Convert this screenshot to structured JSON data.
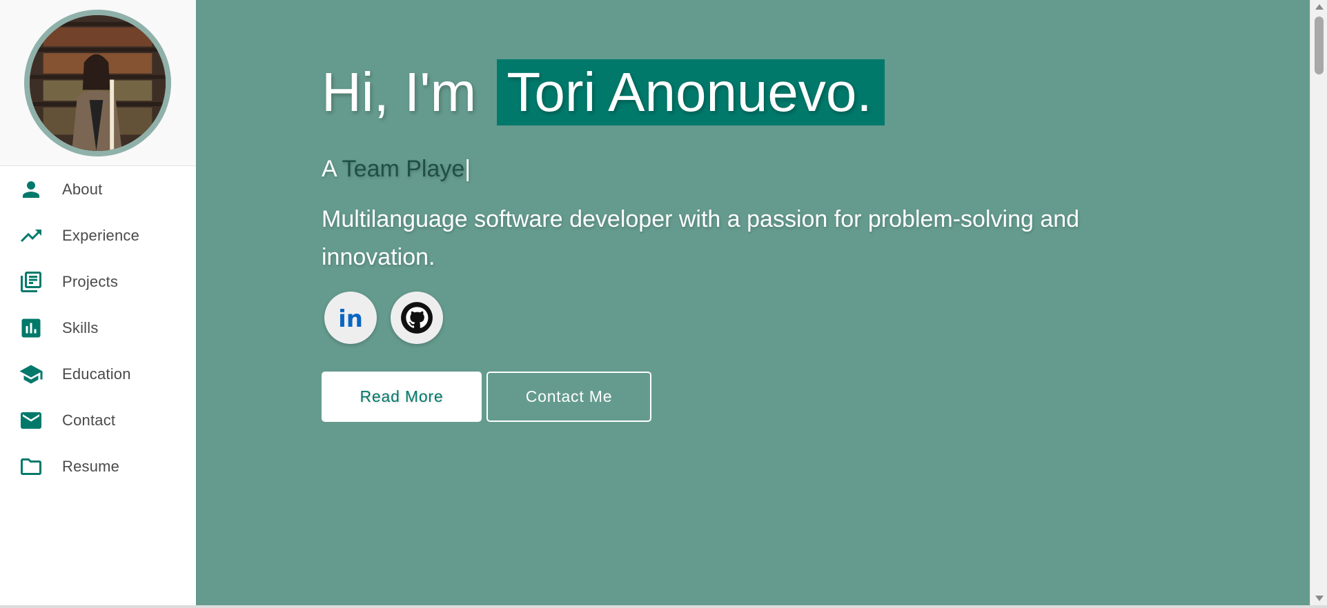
{
  "sidebar": {
    "items": [
      {
        "label": "About",
        "icon": "person-icon"
      },
      {
        "label": "Experience",
        "icon": "trending-up-icon"
      },
      {
        "label": "Projects",
        "icon": "library-books-icon"
      },
      {
        "label": "Skills",
        "icon": "bar-chart-icon"
      },
      {
        "label": "Education",
        "icon": "graduation-cap-icon"
      },
      {
        "label": "Contact",
        "icon": "mail-icon"
      },
      {
        "label": "Resume",
        "icon": "folder-icon"
      }
    ]
  },
  "hero": {
    "greeting": "Hi, I'm",
    "name": "Tori Anonuevo.",
    "tagline_prefix": "A",
    "tagline_typed": "Team Playe",
    "tagline_cursor": "|",
    "description": "Multilanguage software developer with a passion for problem-solving and innovation."
  },
  "socials": [
    {
      "icon": "linkedin-icon",
      "label": "in"
    },
    {
      "icon": "github-icon"
    }
  ],
  "buttons": {
    "read_more": "Read More",
    "contact_me": "Contact Me"
  },
  "colors": {
    "accent": "#00796b",
    "main_background": "#659b8e",
    "avatar_ring": "#8fb1aa",
    "linkedin_blue": "#0a66c2"
  }
}
